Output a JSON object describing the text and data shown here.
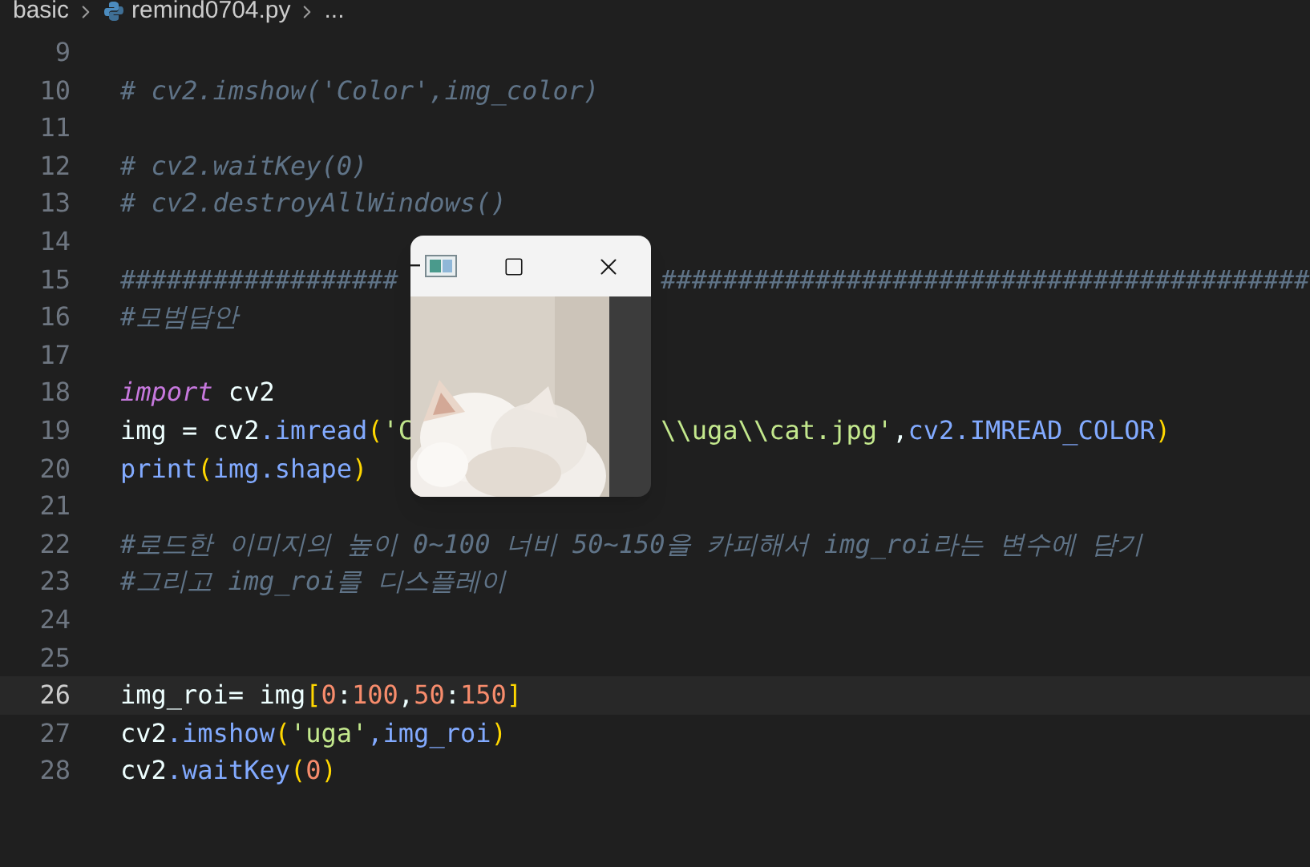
{
  "breadcrumb": [
    {
      "label": "basic",
      "kind": "folder"
    },
    {
      "label": "remind0704.py",
      "kind": "python-file"
    },
    {
      "label": "...",
      "kind": "more"
    }
  ],
  "lines": [
    {
      "number": "9",
      "current": false
    },
    {
      "number": "10",
      "current": false,
      "tokens": [
        {
          "text": "# cv2.imshow('Color',img_color)",
          "kind": "comment"
        }
      ]
    },
    {
      "number": "11",
      "current": false
    },
    {
      "number": "12",
      "current": false,
      "tokens": [
        {
          "text": "# cv2.waitKey(0)",
          "kind": "comment"
        }
      ]
    },
    {
      "number": "13",
      "current": false,
      "tokens": [
        {
          "text": "# cv2.destroyAllWindows()",
          "kind": "comment"
        }
      ]
    },
    {
      "number": "14",
      "current": false
    },
    {
      "number": "15",
      "current": false,
      "tokens": [
        {
          "text": "##################",
          "kind": "comment"
        },
        {
          "kind": "covered"
        },
        {
          "text": "##########################################",
          "kind": "comment"
        }
      ]
    },
    {
      "number": "16",
      "current": false,
      "tokens": [
        {
          "text": "#모범답안",
          "kind": "comment"
        }
      ]
    },
    {
      "number": "17",
      "current": false
    },
    {
      "number": "18",
      "current": false,
      "tokens": [
        {
          "text": "import",
          "kind": "keyword"
        },
        {
          "text": " cv2",
          "kind": "plain"
        }
      ]
    },
    {
      "number": "19",
      "current": false,
      "tokens": [
        {
          "text": "img = cv2",
          "kind": "plain"
        },
        {
          "text": ".imread",
          "kind": "function"
        },
        {
          "text": "(",
          "kind": "bracket"
        },
        {
          "text": "'C",
          "kind": "string"
        },
        {
          "kind": "covered"
        },
        {
          "text": "\\\\uga\\\\cat.jpg'",
          "kind": "string"
        },
        {
          "text": ",",
          "kind": "plain"
        },
        {
          "text": "cv2.IMREAD_COLOR",
          "kind": "function"
        },
        {
          "text": ")",
          "kind": "bracket"
        }
      ]
    },
    {
      "number": "20",
      "current": false,
      "tokens": [
        {
          "text": "print",
          "kind": "function"
        },
        {
          "text": "(",
          "kind": "bracket"
        },
        {
          "text": "img.shape",
          "kind": "function"
        },
        {
          "text": ")",
          "kind": "bracket"
        }
      ]
    },
    {
      "number": "21",
      "current": false
    },
    {
      "number": "22",
      "current": false,
      "tokens": [
        {
          "text": "#로드한 이미지의 높이 0~100 너비 50~150을 카피해서 img_roi라는 변수에 담기",
          "kind": "comment"
        }
      ]
    },
    {
      "number": "23",
      "current": false,
      "tokens": [
        {
          "text": "#그리고 img_roi를 디스플레이",
          "kind": "comment"
        }
      ]
    },
    {
      "number": "24",
      "current": false
    },
    {
      "number": "25",
      "current": false
    },
    {
      "number": "26",
      "current": true,
      "tokens": [
        {
          "text": "img_roi= img",
          "kind": "plain"
        },
        {
          "text": "[",
          "kind": "bracket"
        },
        {
          "text": "0",
          "kind": "number"
        },
        {
          "text": ":",
          "kind": "plain"
        },
        {
          "text": "100",
          "kind": "number"
        },
        {
          "text": ",",
          "kind": "plain"
        },
        {
          "text": "50",
          "kind": "number"
        },
        {
          "text": ":",
          "kind": "plain"
        },
        {
          "text": "150",
          "kind": "number"
        },
        {
          "text": "]",
          "kind": "bracket"
        }
      ]
    },
    {
      "number": "27",
      "current": false,
      "tokens": [
        {
          "text": "cv2",
          "kind": "plain"
        },
        {
          "text": ".imshow",
          "kind": "function"
        },
        {
          "text": "(",
          "kind": "bracket"
        },
        {
          "text": "'uga'",
          "kind": "string"
        },
        {
          "text": ",img_roi",
          "kind": "function"
        },
        {
          "text": ")",
          "kind": "bracket"
        }
      ]
    },
    {
      "number": "28",
      "current": false,
      "tokens": [
        {
          "text": "cv2",
          "kind": "plain"
        },
        {
          "text": ".waitKey",
          "kind": "function"
        },
        {
          "text": "(",
          "kind": "bracket"
        },
        {
          "text": "0",
          "kind": "number"
        },
        {
          "text": ")",
          "kind": "bracket"
        }
      ]
    }
  ]
}
